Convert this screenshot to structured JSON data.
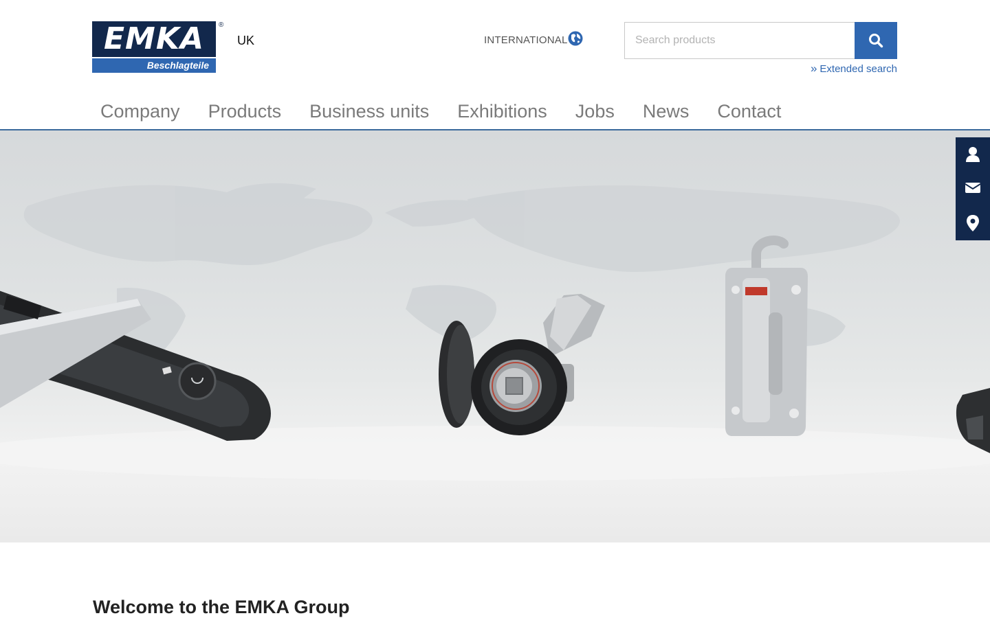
{
  "header": {
    "logo": {
      "wordmark": "EMKA",
      "subtitle": "Beschlagteile",
      "registered": "®"
    },
    "country_label": "UK",
    "international_label": "INTERNATIONAL",
    "search": {
      "placeholder": "Search products",
      "value": ""
    },
    "extended_search": {
      "arrows": "»",
      "label": "Extended search"
    }
  },
  "nav": {
    "items": [
      {
        "label": "Company"
      },
      {
        "label": "Products"
      },
      {
        "label": "Business units"
      },
      {
        "label": "Exhibitions"
      },
      {
        "label": "Jobs"
      },
      {
        "label": "News"
      },
      {
        "label": "Contact"
      }
    ]
  },
  "sidebar": {
    "icons": [
      "user-icon",
      "envelope-icon",
      "map-marker-icon"
    ]
  },
  "main": {
    "heading": "Welcome to the EMKA Group"
  },
  "colors": {
    "brand_dark": "#12284c",
    "brand_blue": "#2f67b1",
    "nav_text": "#7a7a7a"
  }
}
